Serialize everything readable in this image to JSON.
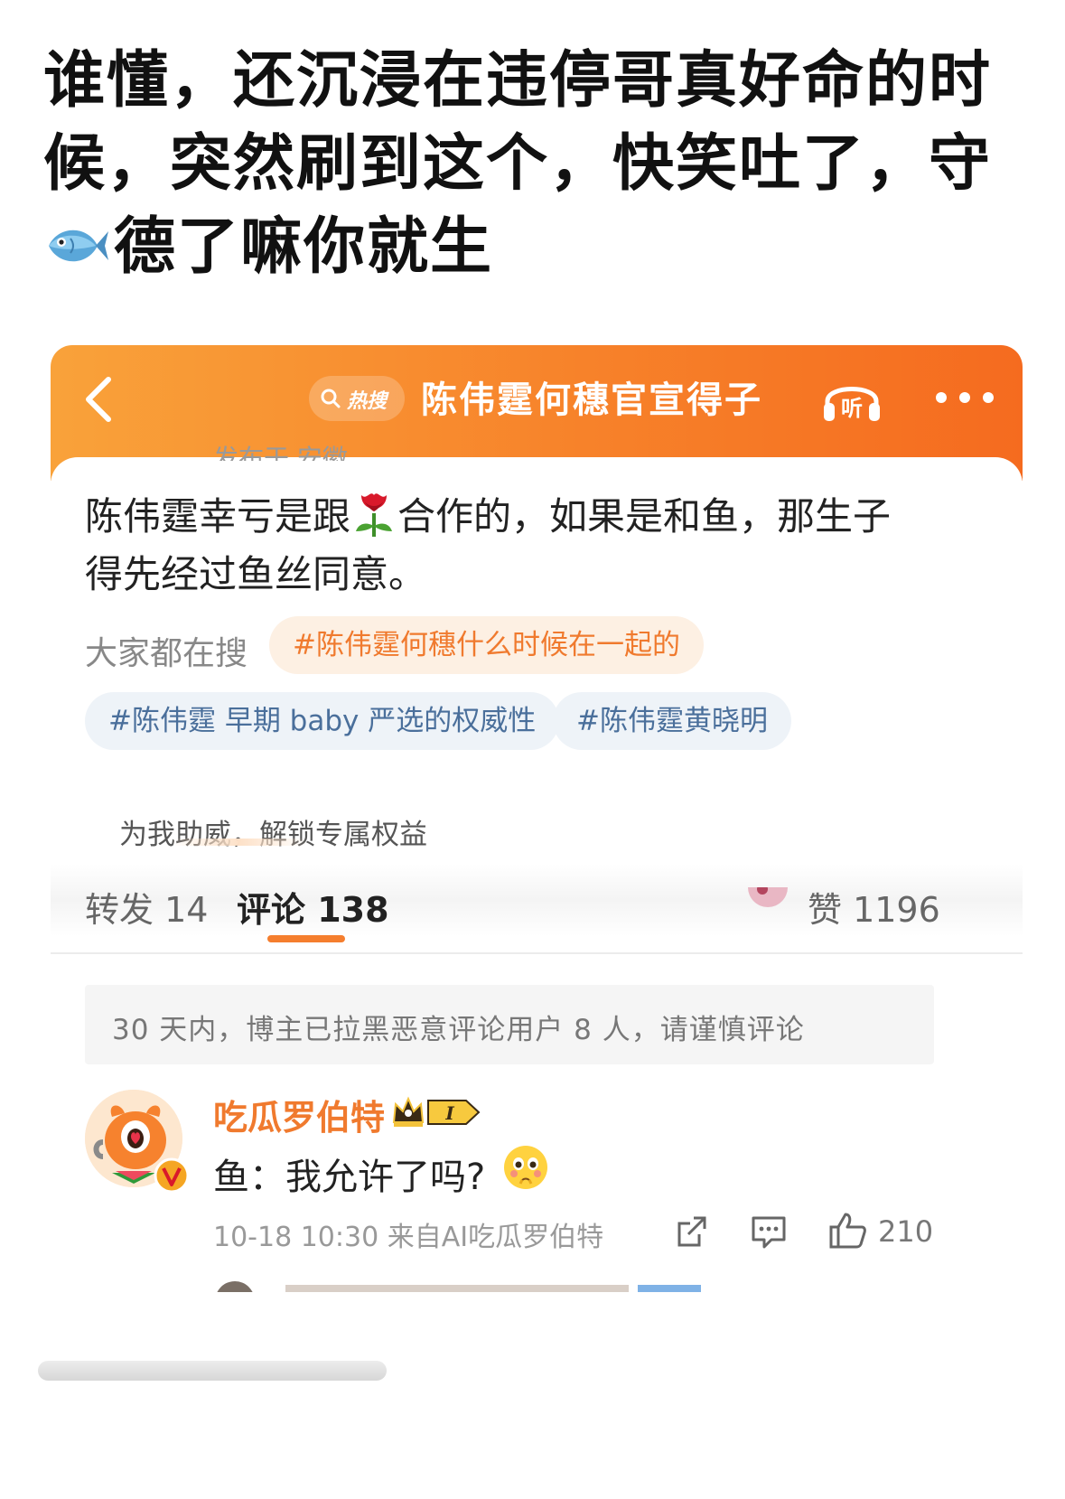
{
  "post": {
    "title_line1": "谁懂，还沉浸在违停哥真好命的时",
    "title_line2": "候，突然刷到这个，快笑吐了，守",
    "title_line3": "德了嘛你就生"
  },
  "topic_header": {
    "hot_label": "热搜",
    "title": "陈伟霆何穗官宣得子",
    "listen_label": "听"
  },
  "comment": {
    "cut_text": "发布于 安徽",
    "text_part1": "陈伟霆幸亏是跟",
    "text_part2": "合作的，如果是和鱼，那生子",
    "text_line2": "得先经过鱼丝同意。"
  },
  "search": {
    "label": "大家都在搜",
    "tags": [
      "#陈伟霆何穗什么时候在一起的",
      "#陈伟霆 早期 baby 严选的权威性",
      "#陈伟霆黄晓明"
    ]
  },
  "support": {
    "text": "为我助威，解锁专属权益"
  },
  "tabs": {
    "repost": "转发 14",
    "comments": "评论 138",
    "likes": "赞 1196"
  },
  "notice": {
    "text": "30 天内，博主已拉黑恶意评论用户 8 人，请谨慎评论"
  },
  "reply": {
    "username": "吃瓜罗伯特",
    "level": "I",
    "text": "鱼：我允许了吗?",
    "meta": "10-18 10:30 来自AI吃瓜罗伯特",
    "like_count": "210"
  },
  "icons": {
    "back": "chevron-left-icon",
    "listen": "headphones-icon",
    "more": "more-dots-icon",
    "share": "share-icon",
    "reply": "comment-icon",
    "like": "thumbs-up-icon"
  },
  "colors": {
    "header_gradient_start": "#f9a23a",
    "header_gradient_end": "#f56b1f",
    "accent_orange": "#f07a2e",
    "hashtag_blue": "#4a6f9b"
  }
}
